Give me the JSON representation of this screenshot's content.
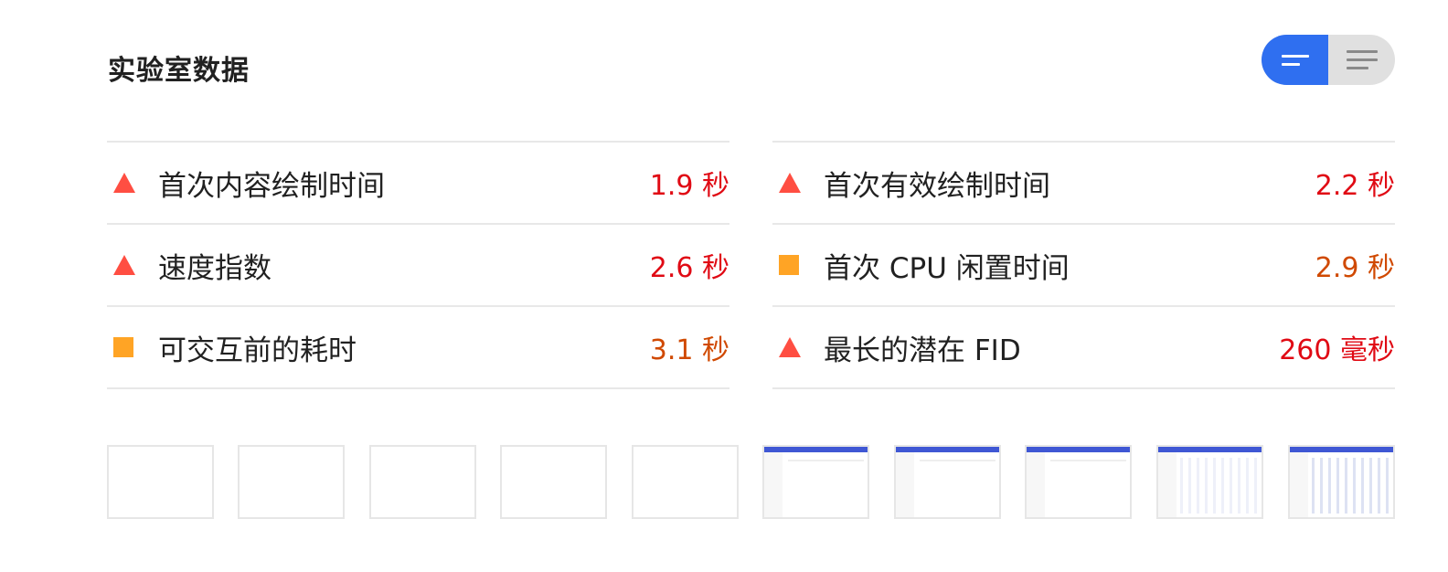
{
  "header": {
    "title": "实验室数据"
  },
  "view_toggle": {
    "options": [
      "list-view",
      "detail-view"
    ],
    "selected": "list-view",
    "active_color": "#2f6ff0"
  },
  "metrics": {
    "left": [
      {
        "icon": "fail-triangle-icon",
        "label": "首次内容绘制时间",
        "value": "1.9 秒",
        "status": "fail"
      },
      {
        "icon": "fail-triangle-icon",
        "label": "速度指数",
        "value": "2.6 秒",
        "status": "fail"
      },
      {
        "icon": "average-square-icon",
        "label": "可交互前的耗时",
        "value": "3.1 秒",
        "status": "average"
      }
    ],
    "right": [
      {
        "icon": "fail-triangle-icon",
        "label": "首次有效绘制时间",
        "value": "2.2 秒",
        "status": "fail"
      },
      {
        "icon": "average-square-icon",
        "label": "首次 CPU 闲置时间",
        "value": "2.9 秒",
        "status": "average"
      },
      {
        "icon": "fail-triangle-icon",
        "label": "最长的潜在 FID",
        "value": "260 毫秒",
        "status": "fail"
      }
    ]
  },
  "colors": {
    "fail": "#e00a14",
    "fail_icon": "#ff4e42",
    "average": "#d04900",
    "average_icon": "#ffa425"
  },
  "filmstrip": {
    "frames": [
      "blank",
      "blank",
      "blank",
      "blank",
      "blank",
      "app-shell",
      "app-shell",
      "app-shell",
      "table-partial",
      "table-full"
    ]
  }
}
